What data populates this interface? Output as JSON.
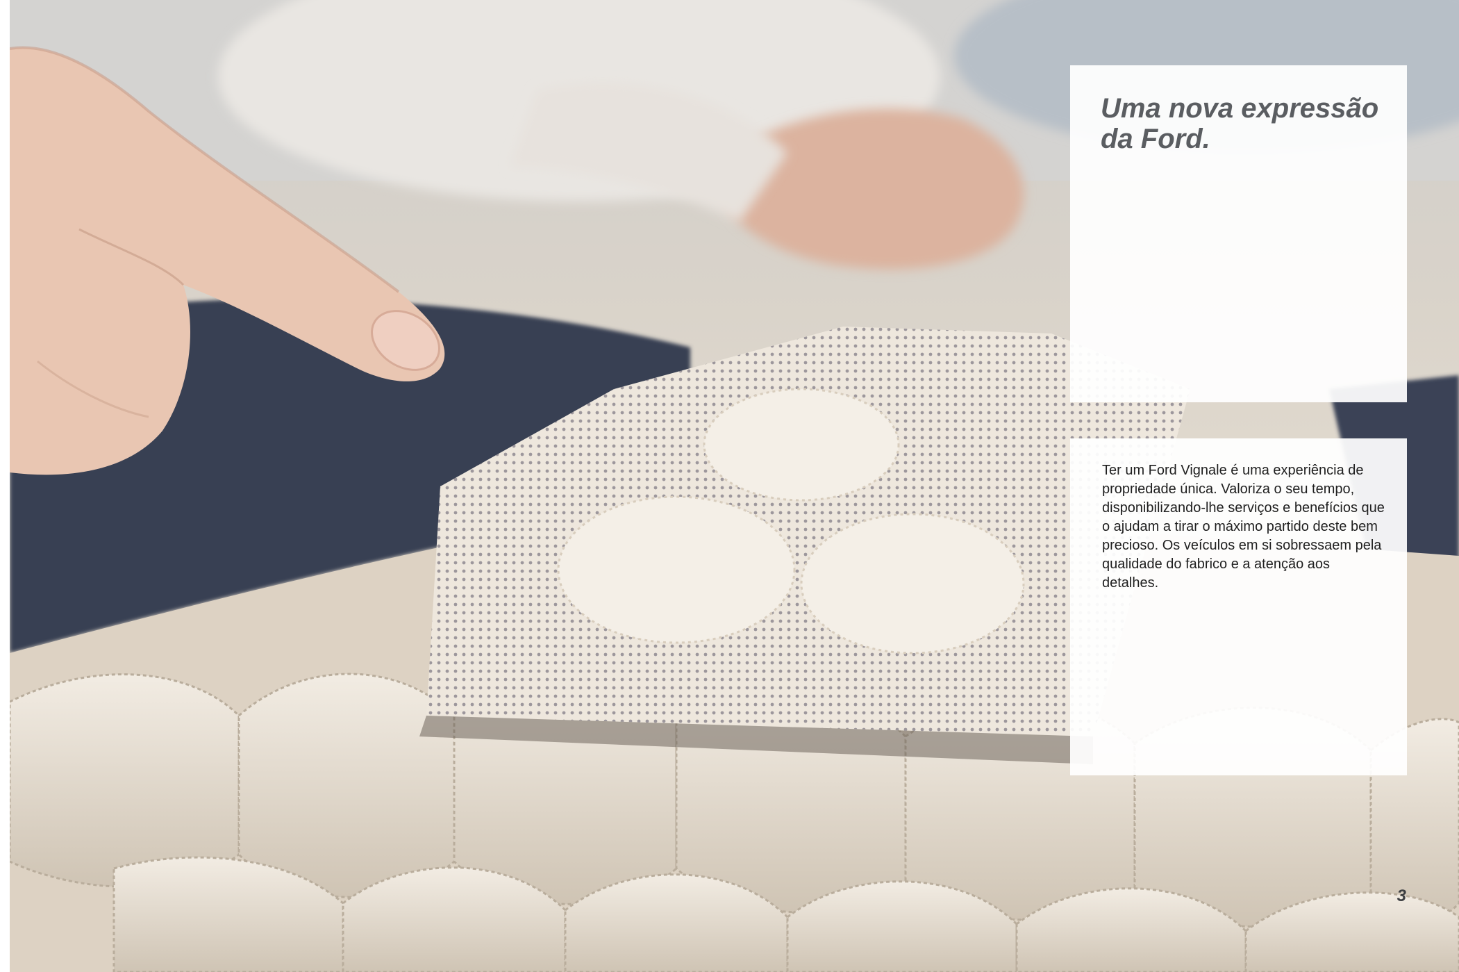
{
  "panel_title": {
    "text": "Uma nova expressão da Ford."
  },
  "panel_body": {
    "text": "Ter um Ford Vignale é uma experiência de propriedade única. Valoriza o seu tempo, disponibilizando-lhe serviços e benefícios que o ajudam a tirar o máximo partido deste bem precioso. Os veículos em si sobressaem pela qualidade do fabrico e a atenção aos detalhes."
  },
  "page": {
    "number": "3"
  },
  "photo": {
    "subject": "hand-pointing-at-quilted-leather-icon",
    "colors": {
      "leather": "#e8dfd2",
      "dark_leather": "#3b4354",
      "skin": "#e8c2ad"
    }
  }
}
